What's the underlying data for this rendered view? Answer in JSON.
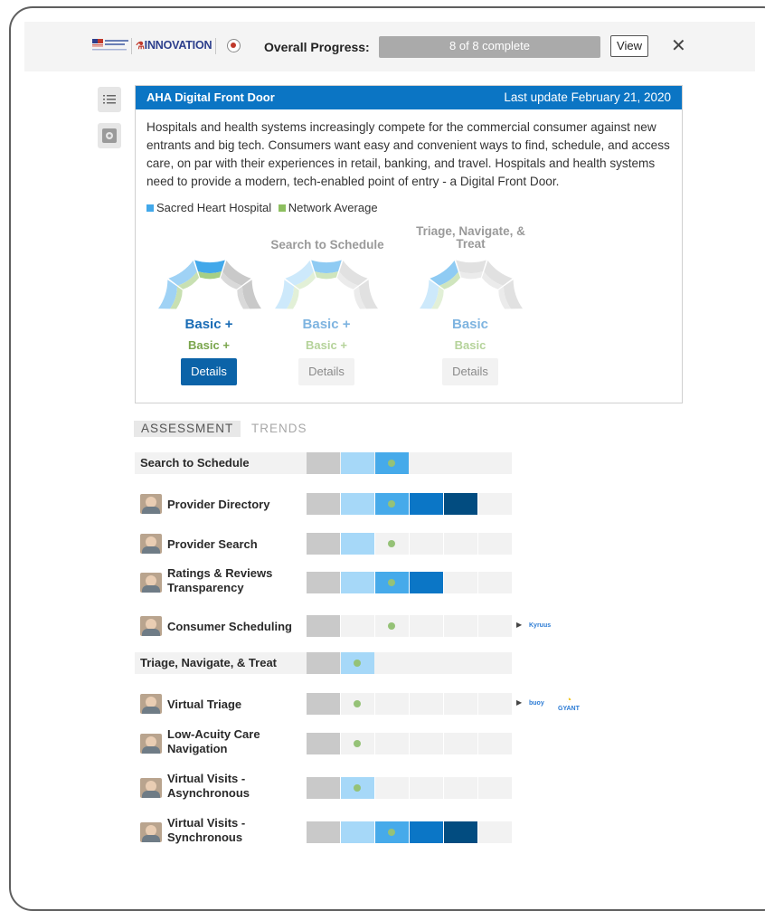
{
  "header": {
    "logo_org": "American Hospital Association",
    "logo_brand": "INNOVATION",
    "logo_tagline": "",
    "progress_label": "Overall Progress:",
    "progress_text": "8 of 8 complete",
    "progress_fraction": 1.0,
    "view_label": "View",
    "close_icon": "close-icon"
  },
  "sidebar": {
    "items": [
      {
        "icon": "list-icon"
      },
      {
        "icon": "gear-icon"
      }
    ]
  },
  "card": {
    "title": "AHA Digital Front Door",
    "updated": "Last update February 21, 2020",
    "description": "Hospitals and health systems increasingly compete for the commercial consumer against new entrants and big tech. Consumers want easy and convenient ways to find, schedule, and access care, on par with their experiences in retail, banking, and travel. Hospitals and health systems need to provide a modern, tech-enabled point of entry - a Digital Front Door.",
    "legend": [
      {
        "label": "Sacred Heart Hospital",
        "color": "#42a8ea"
      },
      {
        "label": "Network Average",
        "color": "#8dbf5f"
      }
    ],
    "gauges": [
      {
        "title": "",
        "hospital_level": "Basic +",
        "network_level": "Basic +",
        "details": "Details",
        "active": true
      },
      {
        "title": "Search to Schedule",
        "hospital_level": "Basic +",
        "network_level": "Basic +",
        "details": "Details",
        "active": false
      },
      {
        "title": "Triage, Navigate, & Treat",
        "hospital_level": "Basic",
        "network_level": "Basic",
        "details": "Details",
        "active": false
      }
    ]
  },
  "tabs": [
    {
      "label": "ASSESSMENT",
      "active": true
    },
    {
      "label": "TRENDS",
      "active": false
    }
  ],
  "colors": {
    "level1": "#c9c9c9",
    "level2": "#a6d8f8",
    "level3": "#46aaea",
    "level4": "#0b76c6",
    "level5": "#024c80",
    "empty": "#f2f2f2",
    "dot": "#95c277"
  },
  "assessment": {
    "sections": [
      {
        "name": "Search to Schedule",
        "level": 3,
        "network": 3,
        "rows": [
          {
            "label": "Provider Directory",
            "level": 5,
            "network": 3,
            "vendors": []
          },
          {
            "label": "Provider Search",
            "level": 2,
            "network": 3,
            "vendors": []
          },
          {
            "label": "Ratings & Reviews Transparency",
            "level": 4,
            "network": 3,
            "vendors": []
          },
          {
            "label": "Consumer Scheduling",
            "level": 1,
            "network": 3,
            "vendors": [
              "Kyruus"
            ]
          }
        ]
      },
      {
        "name": "Triage, Navigate, & Treat",
        "level": 2,
        "network": 2,
        "rows": [
          {
            "label": "Virtual Triage",
            "level": 1,
            "network": 2,
            "vendors": [
              "buoy",
              "GYANT"
            ]
          },
          {
            "label": "Low-Acuity Care Navigation",
            "level": 1,
            "network": 2,
            "vendors": []
          },
          {
            "label": "Virtual Visits - Asynchronous",
            "level": 2,
            "network": 2,
            "vendors": []
          },
          {
            "label": "Virtual Visits - Synchronous",
            "level": 5,
            "network": 3,
            "vendors": []
          }
        ]
      }
    ]
  }
}
